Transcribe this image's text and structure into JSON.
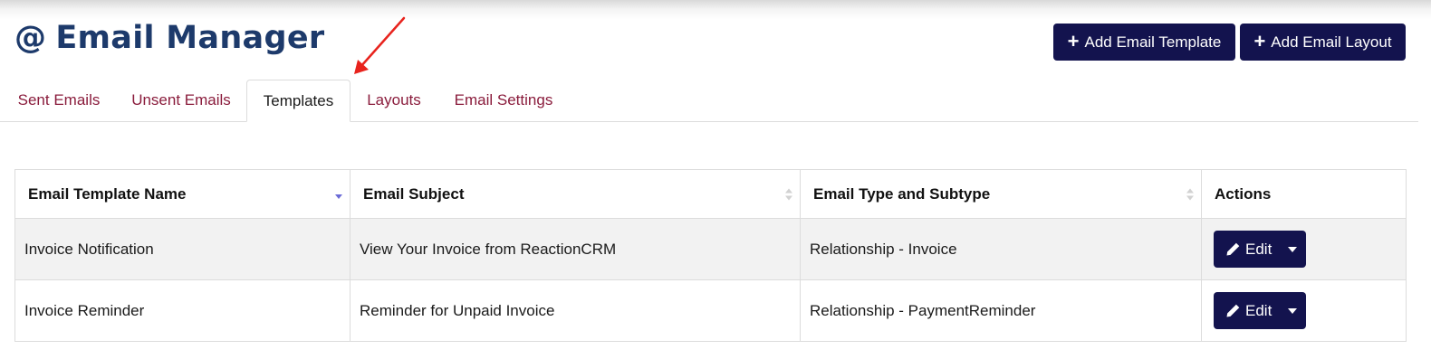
{
  "header": {
    "title_icon": "@",
    "title": "Email Manager",
    "actions": {
      "add_template": "Add Email Template",
      "add_layout": "Add Email Layout"
    }
  },
  "tabs": [
    {
      "label": "Sent Emails",
      "active": false
    },
    {
      "label": "Unsent Emails",
      "active": false
    },
    {
      "label": "Templates",
      "active": true
    },
    {
      "label": "Layouts",
      "active": false
    },
    {
      "label": "Email Settings",
      "active": false
    }
  ],
  "table": {
    "columns": [
      {
        "label": "Email Template Name",
        "sort": "desc"
      },
      {
        "label": "Email Subject",
        "sort": "none"
      },
      {
        "label": "Email Type and Subtype",
        "sort": "none"
      },
      {
        "label": "Actions",
        "sort": null
      }
    ],
    "rows": [
      {
        "name": "Invoice Notification",
        "subject": "View Your Invoice from ReactionCRM",
        "type": "Relationship - Invoice",
        "action_label": "Edit"
      },
      {
        "name": "Invoice Reminder",
        "subject": "Reminder for Unpaid Invoice",
        "type": "Relationship - PaymentReminder",
        "action_label": "Edit"
      }
    ]
  },
  "icons": {
    "plus": "plus-icon",
    "edit": "pencil-icon",
    "dropdown": "caret-down-icon",
    "sort": "sort-icon"
  },
  "colors": {
    "brand_title": "#1d3a6b",
    "primary_button": "#13134e",
    "tab_link": "#8a1c3c",
    "row_stripe": "#f2f2f2",
    "annotation_arrow": "#e8231d",
    "sort_active": "#6b6bd6"
  }
}
